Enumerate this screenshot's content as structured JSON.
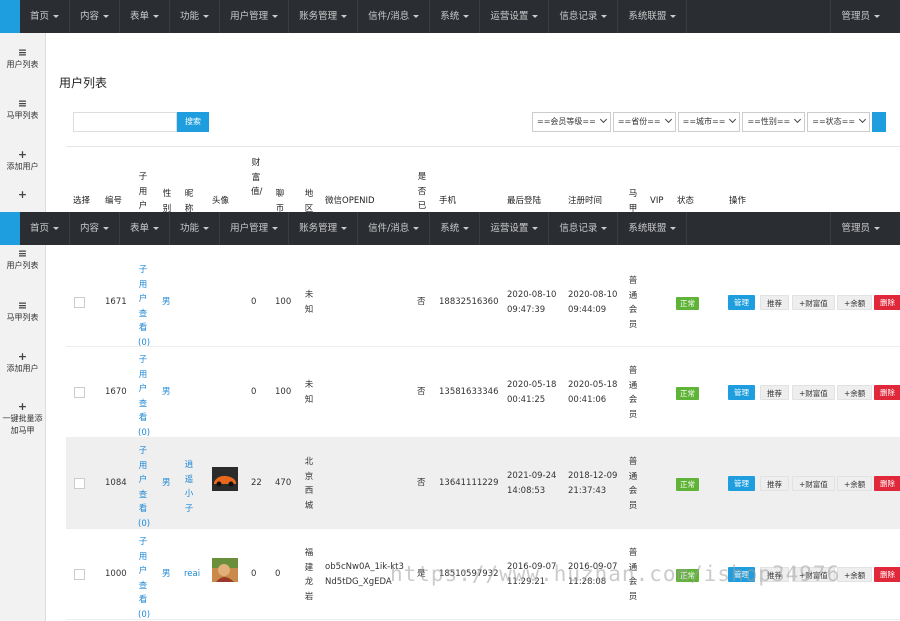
{
  "nav": {
    "items": [
      "首页",
      "内容",
      "表单",
      "功能",
      "用户管理",
      "账务管理",
      "信件/消息",
      "系统",
      "运营设置",
      "信息记录",
      "系统联盟"
    ],
    "admin": "管理员"
  },
  "sidebar": {
    "items": [
      {
        "icon": "list-icon",
        "label": "用户列表"
      },
      {
        "icon": "list-icon",
        "label": "马甲列表"
      },
      {
        "icon": "plus-icon",
        "label": "添加用户"
      },
      {
        "icon": "plus-icon",
        "label": "一键批量添加马甲"
      }
    ]
  },
  "page": {
    "title": "用户列表",
    "search_placeholder": "",
    "search_button": "搜索",
    "filters": [
      "==会员等级==",
      "==省份==",
      "==城市==",
      "==性别==",
      "==状态=="
    ]
  },
  "table": {
    "headers": {
      "select": "选择",
      "id": "编号",
      "subusers": "子用户",
      "gender": "性别",
      "nickname": "昵称",
      "avatar": "头像",
      "wealth": "财富值/",
      "coins": "聊币",
      "region": "地区",
      "openid": "微信OPENID",
      "followed": "是否已关注",
      "phone": "手机",
      "last_login": "最后登陆",
      "reg_time": "注册时间",
      "vest": "马甲",
      "vip": "VIP",
      "status": "状态",
      "actions": "操作"
    },
    "subuser_text": "子用户查看(0)",
    "row_actions": {
      "manage": "管理",
      "recommend": "推荐",
      "wealth": "+财富值",
      "balance": "+余额",
      "delete": "删除"
    },
    "rows": [
      {
        "id": "1671",
        "gender": "男",
        "nickname": "",
        "wealth": "0",
        "coins": "100",
        "region": "未知",
        "openid": "",
        "followed": "否",
        "phone": "18832516360",
        "last_login": "2020-08-10 09:47:39",
        "reg_time": "2020-08-10 09:44:09",
        "vip": "普通会员",
        "status": "正常",
        "actions": {
          "manage": "管理",
          "recommend": "推荐",
          "wealth": "+财富值",
          "balance": "+余额",
          "delete": "删除"
        }
      },
      {
        "id": "1670",
        "gender": "男",
        "nickname": "",
        "wealth": "0",
        "coins": "100",
        "region": "未知",
        "openid": "",
        "followed": "否",
        "phone": "13581633346",
        "last_login": "2020-05-18 00:41:25",
        "reg_time": "2020-05-18 00:41:06",
        "vip": "普通会员",
        "status": "正常",
        "actions": {
          "manage": "管理",
          "recommend": "推荐",
          "wealth": "+财富值",
          "balance": "+余额",
          "delete": "删除"
        }
      },
      {
        "id": "1084",
        "gender": "男",
        "nickname": "逍遥小子",
        "wealth": "22",
        "coins": "470",
        "region": "北京西城",
        "openid": "",
        "followed": "否",
        "phone": "13641111229",
        "last_login": "2021-09-24 14:08:53",
        "reg_time": "2018-12-09 21:37:43",
        "vip": "普通会员",
        "status": "正常",
        "actions": {
          "manage": "管理",
          "recommend": "推荐",
          "wealth": "+财富值",
          "balance": "+余额",
          "delete": "删除"
        }
      },
      {
        "id": "1000",
        "gender": "男",
        "nickname": "reai",
        "wealth": "0",
        "coins": "0",
        "region": "福建龙岩",
        "openid": "ob5cNw0A_1ik-kt3Nd5tDG_XgEDA",
        "followed": "是",
        "phone": "18510597932",
        "last_login": "2016-09-07 11:29:21",
        "reg_time": "2016-09-07 11:28:08",
        "vip": "普通会员",
        "status": "正常",
        "actions": {
          "manage": "管理",
          "recommend": "推荐",
          "wealth": "+财富值",
          "balance": "+余额",
          "delete": "删除"
        }
      }
    ]
  },
  "watermark": "https://www.huzhan.com/ishop34976",
  "colors": {
    "topbar": "#2a2d32",
    "accent": "#1e9ede",
    "ok": "#5fb336",
    "danger": "#e0283a",
    "link": "#1e88d6"
  }
}
